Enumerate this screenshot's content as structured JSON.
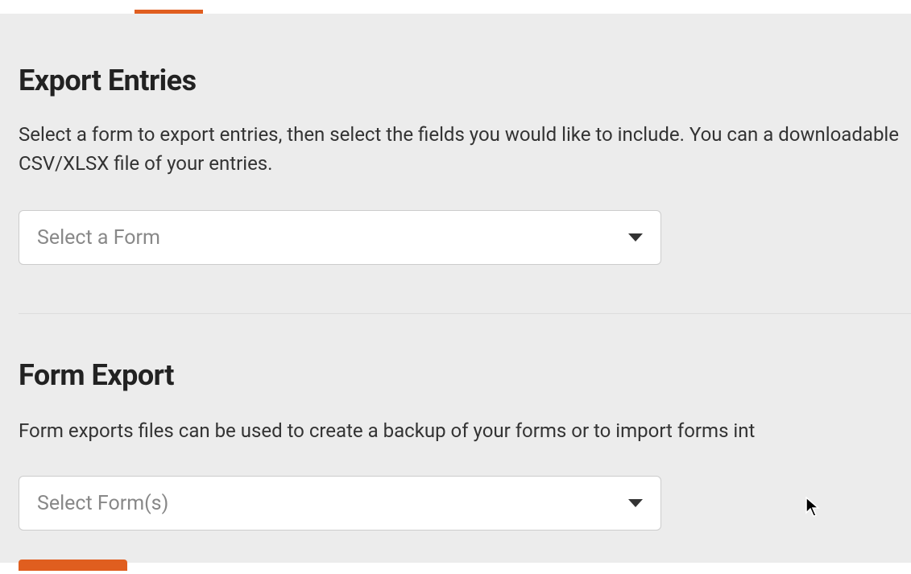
{
  "export_entries": {
    "heading": "Export Entries",
    "description": "Select a form to export entries, then select the fields you would like to include. You can a downloadable CSV/XLSX file of your entries.",
    "dropdown_placeholder": "Select a Form"
  },
  "form_export": {
    "heading": "Form Export",
    "description": "Form exports files can be used to create a backup of your forms or to import forms int",
    "dropdown_placeholder": "Select Form(s)"
  }
}
